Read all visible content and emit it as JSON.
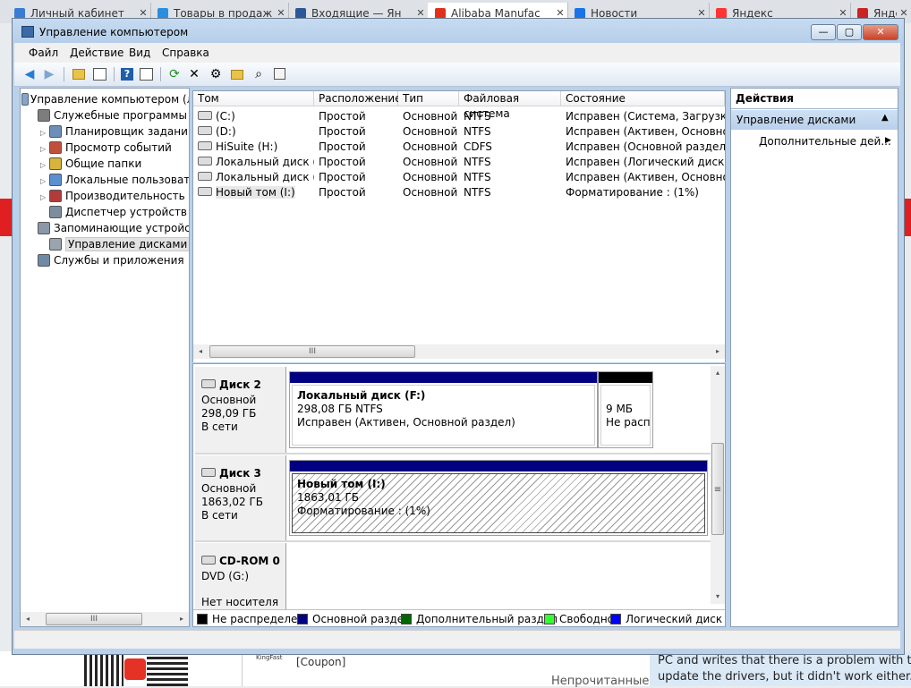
{
  "browser": {
    "tabs": [
      {
        "label": "Личный кабинет",
        "favicon_color": "#3a7bd5"
      },
      {
        "label": "Товары в продаж",
        "favicon_color": "#2a8ee0"
      },
      {
        "label": "Входящие — Ян",
        "favicon_color": "#2b579a"
      },
      {
        "label": "Alibaba Manufac",
        "favicon_color": "#e0301e"
      },
      {
        "label": "Новости",
        "favicon_color": "#1a73e8"
      },
      {
        "label": "Яндекс",
        "favicon_color": "#ff3333"
      },
      {
        "label": "Яндекс",
        "favicon_color": "#cc2222"
      }
    ],
    "close_glyph": "✕",
    "bg_coupon": "[Coupon]",
    "bg_kingfast": "KingFast",
    "bg_unread": "Непрочитанные",
    "bg_text_line1": "PC and writes that there is a problem with the",
    "bg_text_line2": "update the drivers, but it didn't work either."
  },
  "window": {
    "title": "Управление компьютером",
    "buttons": {
      "minimize": "—",
      "maximize": "▢",
      "close": "✕"
    }
  },
  "menu": [
    "Файл",
    "Действие",
    "Вид",
    "Справка"
  ],
  "toolbar": [
    "back-icon",
    "forward-icon",
    "up-folder-icon",
    "show-hide-tree-icon",
    "help-icon",
    "properties-icon",
    "refresh-icon",
    "delete-icon",
    "settings-icon",
    "open-icon",
    "search-icon",
    "export-icon"
  ],
  "tree": {
    "root": "Управление компьютером (лока",
    "items": [
      {
        "label": "Служебные программы",
        "level": 1,
        "expander": "",
        "icon": "tools-icon"
      },
      {
        "label": "Планировщик заданий",
        "level": 2,
        "expander": "▷",
        "icon": "clock-icon"
      },
      {
        "label": "Просмотр событий",
        "level": 2,
        "expander": "▷",
        "icon": "event-log-icon"
      },
      {
        "label": "Общие папки",
        "level": 2,
        "expander": "▷",
        "icon": "shared-folder-icon"
      },
      {
        "label": "Локальные пользовател",
        "level": 2,
        "expander": "▷",
        "icon": "users-icon"
      },
      {
        "label": "Производительность",
        "level": 2,
        "expander": "▷",
        "icon": "performance-icon"
      },
      {
        "label": "Диспетчер устройств",
        "level": 2,
        "expander": "",
        "icon": "device-manager-icon"
      },
      {
        "label": "Запоминающие устройства",
        "level": 1,
        "expander": "",
        "icon": "storage-icon"
      },
      {
        "label": "Управление дисками",
        "level": 2,
        "expander": "",
        "icon": "disk-management-icon"
      },
      {
        "label": "Службы и приложения",
        "level": 1,
        "expander": "",
        "icon": "services-icon"
      }
    ]
  },
  "volumes": {
    "columns": [
      "Том",
      "Расположение",
      "Тип",
      "Файловая система",
      "Состояние"
    ],
    "rows": [
      [
        "(C:)",
        "Простой",
        "Основной",
        "NTFS",
        "Исправен (Система, Загрузка, Ф"
      ],
      [
        "(D:)",
        "Простой",
        "Основной",
        "NTFS",
        "Исправен (Активен, Основной р"
      ],
      [
        "HiSuite (H:)",
        "Простой",
        "Основной",
        "CDFS",
        "Исправен (Основной раздел)"
      ],
      [
        "Локальный диск (E:)",
        "Простой",
        "Основной",
        "NTFS",
        "Исправен (Логический диск)"
      ],
      [
        "Локальный диск (F:)",
        "Простой",
        "Основной",
        "NTFS",
        "Исправен (Активен, Основной р"
      ],
      [
        "Новый том (I:)",
        "Простой",
        "Основной",
        "NTFS",
        "Форматирование : (1%)"
      ]
    ]
  },
  "disks": [
    {
      "name": "Диск 2",
      "kind": "Основной",
      "size": "298,09 ГБ",
      "state": "В сети",
      "partitions": [
        {
          "name": "Локальный диск  (F:)",
          "line2": "298,08 ГБ NTFS",
          "line3": "Исправен (Активен, Основной раздел)"
        },
        {
          "name": "",
          "line2": "9 МБ",
          "line3": "Не распр"
        }
      ]
    },
    {
      "name": "Диск 3",
      "kind": "Основной",
      "size": "1863,02 ГБ",
      "state": "В сети",
      "partitions": [
        {
          "name": "Новый том  (I:)",
          "line2": "1863,01 ГБ",
          "line3": "Форматирование : (1%)"
        }
      ]
    },
    {
      "name": "CD-ROM 0",
      "kind": "DVD (G:)",
      "size": "",
      "state": "Нет носителя",
      "partitions": []
    }
  ],
  "legend": [
    {
      "label": "Не распределен",
      "color": "#000000"
    },
    {
      "label": "Основной раздел",
      "color": "#000080"
    },
    {
      "label": "Дополнительный раздел",
      "color": "#006600"
    },
    {
      "label": "Свободно",
      "color": "#33ff33"
    },
    {
      "label": "Логический диск",
      "color": "#0000ff"
    }
  ],
  "actions": {
    "header": "Действия",
    "section": "Управление дисками",
    "section_arrow": "▲",
    "item": "Дополнительные дей...",
    "item_arrow": "▶"
  },
  "scroll": {
    "left": "◂",
    "right": "▸",
    "up": "▴",
    "down": "▾",
    "grip": "III",
    "vgrip": "≡"
  }
}
